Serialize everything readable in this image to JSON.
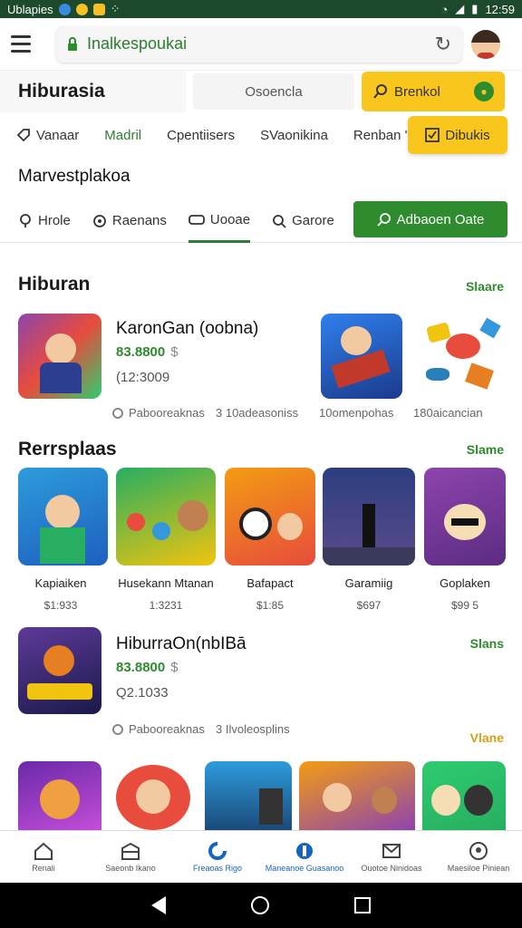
{
  "status_bar": {
    "app_label": "Ublapies",
    "time": "12:59"
  },
  "browser": {
    "url": "Inalkespoukai"
  },
  "header": {
    "site_title": "Hiburasia",
    "search_label": "Osoencla",
    "yellow_button": "Brenkol"
  },
  "categories": [
    {
      "label": "Vanaar",
      "active": false
    },
    {
      "label": "Madril",
      "active": true
    },
    {
      "label": "Cpentiisers",
      "active": false
    },
    {
      "label": "SVaonikina",
      "active": false
    },
    {
      "label": "Renban '",
      "active": false
    }
  ],
  "yellow_box_label": "Dibukis",
  "marketplace_title": "Marvestplakoa",
  "nav": {
    "items": [
      {
        "label": "Hrole",
        "active": false
      },
      {
        "label": "Raenans",
        "active": false
      },
      {
        "label": "Uooae",
        "active": true
      },
      {
        "label": "Garore",
        "active": false
      }
    ],
    "green_button": "Adbaoen Oate"
  },
  "section1": {
    "title": "Hiburan",
    "see_more": "Slaare",
    "featured": {
      "name": "KaronGan (oobna)",
      "price": "83.8800",
      "currency": "$",
      "sub": "(12:3009",
      "meta": "Pabooreaknas"
    },
    "meta_right": [
      "3 10adeasoniss",
      "10omenpohas",
      "180aicancian"
    ]
  },
  "section2": {
    "title": "Rerrsplaas",
    "see_more": "Slame",
    "games": [
      {
        "name": "Kapiaiken",
        "price": "$1:933"
      },
      {
        "name": "Husekann Mtanan",
        "price": "1:3231"
      },
      {
        "name": "Bafapact",
        "price": "$1:85"
      },
      {
        "name": "Garamiig",
        "price": "$697"
      },
      {
        "name": "Goplaken",
        "price": "$99 5"
      }
    ]
  },
  "section3": {
    "title": "HiburraOn(nbIBā",
    "see_more": "Slans",
    "price": "83.8800",
    "currency": "$",
    "sub": "Q2.1033",
    "meta": "Pabooreaknas",
    "meta2": "3 Ilvoleosplins",
    "see_more2": "Vlane"
  },
  "bottom_nav": [
    {
      "label": "Renali",
      "icon": "home-icon"
    },
    {
      "label": "Saeonb Ikano",
      "icon": "store-icon"
    },
    {
      "label": "Freaoas Rigo",
      "icon": "discover-icon"
    },
    {
      "label": "Maneanoe Guasanoo",
      "icon": "games-icon"
    },
    {
      "label": "Ouotoe Ninidoas",
      "icon": "mail-icon"
    },
    {
      "label": "Maesiloe Piniean",
      "icon": "profile-icon"
    }
  ],
  "colors": {
    "accent_green": "#2e8b2e",
    "accent_yellow": "#f8c61c",
    "status_bar": "#1d4a2c"
  }
}
